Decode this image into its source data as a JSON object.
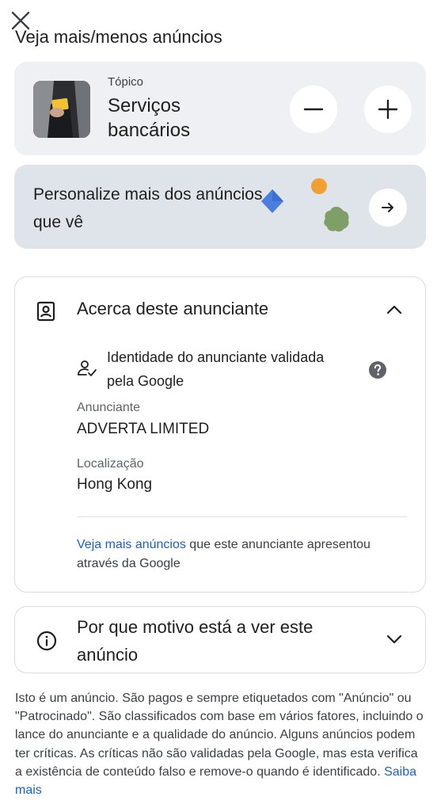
{
  "header": {
    "title": "Veja mais/menos anúncios"
  },
  "topic": {
    "label": "Tópico",
    "name": "Serviços bancários"
  },
  "personalize": {
    "text": "Personalize mais dos anúncios que vê"
  },
  "about": {
    "heading": "Acerca deste anunciante",
    "verified_text": "Identidade do anunciante validada pela Google",
    "advertiser_label": "Anunciante",
    "advertiser_value": "ADVERTA LIMITED",
    "location_label": "Localização",
    "location_value": "Hong Kong",
    "more_ads_link": "Veja mais anúncios",
    "more_ads_rest": " que este anunciante apresentou através da Google"
  },
  "why": {
    "heading": "Por que motivo está a ver este anúncio"
  },
  "disclaimer": {
    "text": "Isto é um anúncio. São pagos e sempre etiquetados com \"Anúncio\" ou \"Patrocinado\". São classificados com base em vários fatores, incluindo o lance do anunciante e a qualidade do anúncio. Alguns anúncios podem ter críticas. As críticas não são validadas pela Google, mas esta verifica a existência de conteúdo falso e remove-o quando é identificado. ",
    "link": "Saiba mais"
  },
  "colors": {
    "link": "#1a62c3",
    "card_bg": "#eef0f4",
    "personalize_bg": "#dfe3ea",
    "card_border": "#dadce0"
  },
  "icons": {
    "close": "close-icon",
    "minus": "minus-icon",
    "plus": "plus-icon",
    "arrow": "arrow-right-icon",
    "advertiser": "advertiser-badge-icon",
    "chevron_up": "chevron-up-icon",
    "verified": "verified-person-icon",
    "help": "help-icon",
    "info": "info-icon",
    "chevron_down": "chevron-down-icon"
  }
}
